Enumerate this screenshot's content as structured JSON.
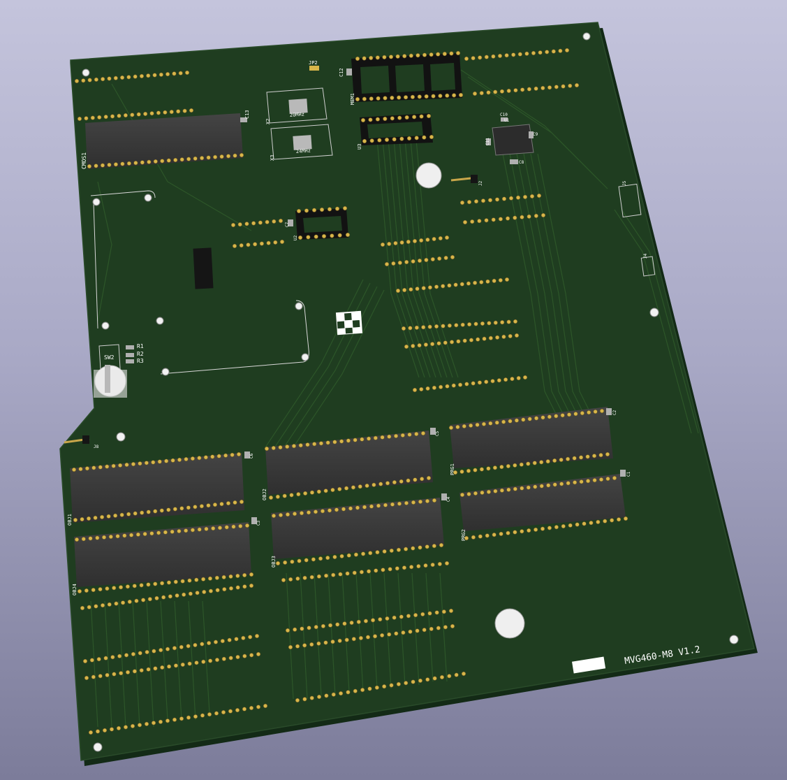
{
  "board": {
    "title": "MVG460-M8 V1.2",
    "colors": {
      "background_top": "#c4c4dc",
      "background_bottom": "#7c7c9a",
      "pcb": "#1e3b1e",
      "pcb_edge": "#16301a",
      "chip_body": "#3a3a3a",
      "socket": "#141414",
      "pad": "#d8b64a",
      "silkscreen": "#ffffff",
      "trace": "#2b5228"
    }
  },
  "references": {
    "c13": "C13",
    "cmos": "CMOS1",
    "jp2": "JP2",
    "c12": "C12",
    "mem": "MEM1",
    "x2": "X2",
    "x3": "X3",
    "osc1": "20MHz",
    "osc2": "24MHz",
    "u3": "U3",
    "c10": "C10",
    "u1": "U1",
    "c8": "C8",
    "c9": "C9",
    "c11": "C11",
    "j2": "J2",
    "j5": "J5",
    "j4": "J4",
    "c7": "C7",
    "u2": "U2",
    "r1": "R1",
    "r2": "R2",
    "r3": "R3",
    "sw2": "SW2",
    "j8": "J8",
    "c6": "C6",
    "c3": "C3",
    "c5": "C5",
    "c4": "C4",
    "c2": "C2",
    "c1": "C1",
    "obj1": "OBJ1",
    "obj2": "OBJ2",
    "obj3": "OBJ3",
    "obj4": "OBJ4",
    "prg1": "PRG1",
    "prg2": "PRG2"
  }
}
